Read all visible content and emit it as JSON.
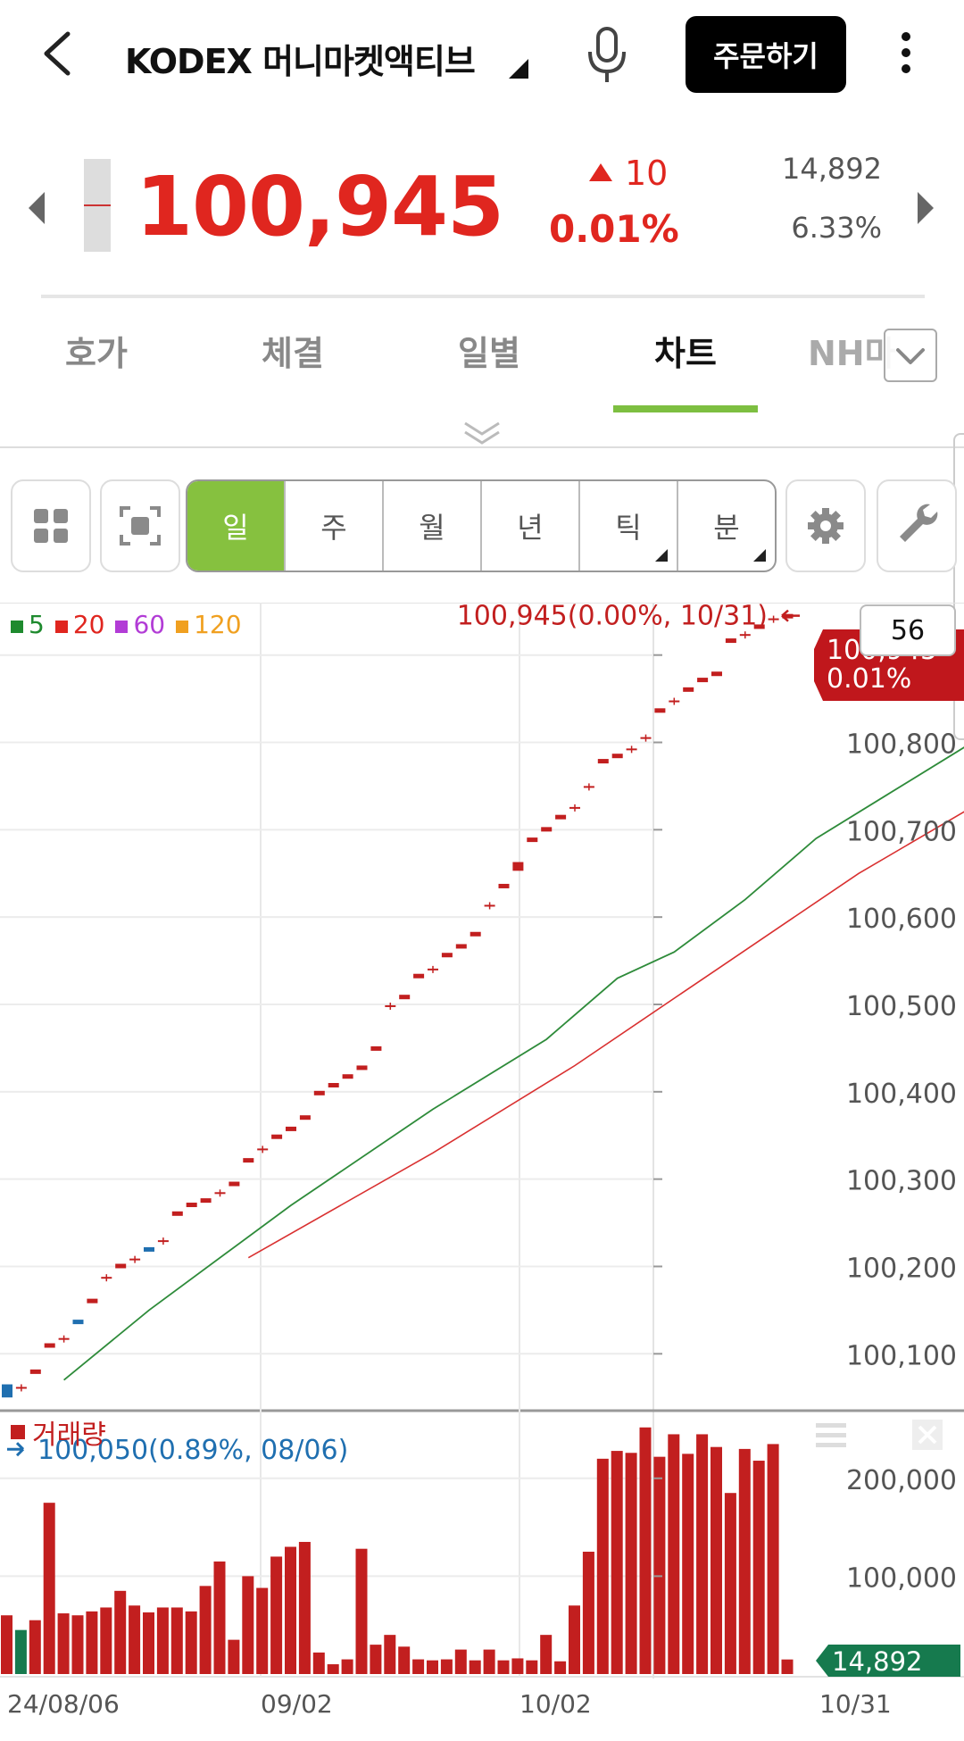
{
  "header": {
    "title": "KODEX 머니마켓액티브",
    "order_label": "주문하기"
  },
  "quote": {
    "price": "100,945",
    "change": "10",
    "change_pct": "0.01%",
    "volume": "14,892",
    "turnover_rate": "6.33%",
    "up_color": "#e0261f"
  },
  "tabs": [
    {
      "label": "호가"
    },
    {
      "label": "체결"
    },
    {
      "label": "일별"
    },
    {
      "label": "차트",
      "active": true
    },
    {
      "label": "NH마"
    }
  ],
  "toolbar": {
    "periods": [
      {
        "label": "일",
        "active": true
      },
      {
        "label": "주"
      },
      {
        "label": "월"
      },
      {
        "label": "년"
      },
      {
        "label": "틱",
        "has_menu": true
      },
      {
        "label": "분",
        "has_menu": true
      }
    ],
    "icons": [
      "grid-icon",
      "capture-icon",
      "gear-icon",
      "wrench-icon"
    ],
    "accent": "#86c13f"
  },
  "chart": {
    "ma_legend": [
      {
        "label": "5",
        "color": "#1e8a2e"
      },
      {
        "label": "20",
        "color": "#e0261f"
      },
      {
        "label": "60",
        "color": "#b23cd6"
      },
      {
        "label": "120",
        "color": "#f0a020"
      }
    ],
    "qty_badge": "56",
    "high_annotation": "100,945(0.00%, 10/31)",
    "low_annotation": "100,050(0.89%, 08/06)",
    "last_price_tag": "100,945",
    "last_pct_tag": "0.01%",
    "volume_label": "거래량",
    "volume_tag": "14,892",
    "x_labels": [
      "24/08/06",
      "09/02",
      "10/02",
      "10/31"
    ]
  },
  "chart_data": [
    {
      "type": "candlestick",
      "title": "",
      "ylim": [
        100040,
        100960
      ],
      "yticks": [
        100100,
        100200,
        100300,
        100400,
        100500,
        100600,
        100700,
        100800,
        100900
      ],
      "ytick_labels": [
        "100,100",
        "100,200",
        "100,300",
        "100,400",
        "100,500",
        "100,600",
        "100,700",
        "100,800",
        "100,900"
      ],
      "x_tick_labels": [
        "24/08/06",
        "09/02",
        "10/02",
        "10/31"
      ],
      "candles": [
        {
          "o": 100050,
          "c": 100065,
          "d": -1
        },
        {
          "o": 100061,
          "c": 100061,
          "d": 0
        },
        {
          "o": 100076,
          "c": 100080,
          "d": 1
        },
        {
          "o": 100106,
          "c": 100110,
          "d": 1
        },
        {
          "o": 100117,
          "c": 100117,
          "d": 0
        },
        {
          "o": 100137,
          "c": 100133,
          "d": -1
        },
        {
          "o": 100157,
          "c": 100161,
          "d": 1
        },
        {
          "o": 100187,
          "c": 100187,
          "d": 0
        },
        {
          "o": 100197,
          "c": 100201,
          "d": 1
        },
        {
          "o": 100208,
          "c": 100208,
          "d": 0
        },
        {
          "o": 100220,
          "c": 100216,
          "d": -1
        },
        {
          "o": 100229,
          "c": 100229,
          "d": 0
        },
        {
          "o": 100257,
          "c": 100261,
          "d": 1
        },
        {
          "o": 100267,
          "c": 100271,
          "d": 1
        },
        {
          "o": 100272,
          "c": 100276,
          "d": 1
        },
        {
          "o": 100284,
          "c": 100284,
          "d": 0
        },
        {
          "o": 100291,
          "c": 100295,
          "d": 1
        },
        {
          "o": 100318,
          "c": 100322,
          "d": 1
        },
        {
          "o": 100334,
          "c": 100334,
          "d": 0
        },
        {
          "o": 100345,
          "c": 100349,
          "d": 1
        },
        {
          "o": 100354,
          "c": 100358,
          "d": 1
        },
        {
          "o": 100367,
          "c": 100371,
          "d": 1
        },
        {
          "o": 100395,
          "c": 100399,
          "d": 1
        },
        {
          "o": 100404,
          "c": 100408,
          "d": 1
        },
        {
          "o": 100414,
          "c": 100418,
          "d": 1
        },
        {
          "o": 100424,
          "c": 100428,
          "d": 1
        },
        {
          "o": 100446,
          "c": 100450,
          "d": 1
        },
        {
          "o": 100498,
          "c": 100498,
          "d": 0
        },
        {
          "o": 100505,
          "c": 100509,
          "d": 1
        },
        {
          "o": 100529,
          "c": 100533,
          "d": 1
        },
        {
          "o": 100540,
          "c": 100540,
          "d": 0
        },
        {
          "o": 100553,
          "c": 100557,
          "d": 1
        },
        {
          "o": 100563,
          "c": 100567,
          "d": 1
        },
        {
          "o": 100577,
          "c": 100581,
          "d": 1
        },
        {
          "o": 100613,
          "c": 100613,
          "d": 0
        },
        {
          "o": 100632,
          "c": 100636,
          "d": 1
        },
        {
          "o": 100653,
          "c": 100663,
          "d": 1
        },
        {
          "o": 100685,
          "c": 100689,
          "d": 1
        },
        {
          "o": 100697,
          "c": 100701,
          "d": 1
        },
        {
          "o": 100711,
          "c": 100715,
          "d": 1
        },
        {
          "o": 100725,
          "c": 100725,
          "d": 0
        },
        {
          "o": 100749,
          "c": 100749,
          "d": 0
        },
        {
          "o": 100775,
          "c": 100779,
          "d": 1
        },
        {
          "o": 100781,
          "c": 100785,
          "d": 1
        },
        {
          "o": 100792,
          "c": 100792,
          "d": 0
        },
        {
          "o": 100805,
          "c": 100805,
          "d": 0
        },
        {
          "o": 100833,
          "c": 100837,
          "d": 1
        },
        {
          "o": 100847,
          "c": 100847,
          "d": 0
        },
        {
          "o": 100857,
          "c": 100861,
          "d": 1
        },
        {
          "o": 100868,
          "c": 100872,
          "d": 1
        },
        {
          "o": 100875,
          "c": 100879,
          "d": 1
        },
        {
          "o": 100913,
          "c": 100917,
          "d": 1
        },
        {
          "o": 100923,
          "c": 100923,
          "d": 0
        },
        {
          "o": 100929,
          "c": 100933,
          "d": 1
        },
        {
          "o": 100941,
          "c": 100941,
          "d": 0
        },
        {
          "o": 100941,
          "c": 100945,
          "d": 1
        }
      ],
      "ma5": [
        [
          4,
          100070
        ],
        [
          10,
          100150
        ],
        [
          20,
          100270
        ],
        [
          30,
          100380
        ],
        [
          38,
          100460
        ],
        [
          43,
          100530
        ],
        [
          47,
          100560
        ],
        [
          52,
          100620
        ],
        [
          57,
          100690
        ],
        [
          62,
          100740
        ],
        [
          67,
          100790
        ],
        [
          72,
          100840
        ],
        [
          77,
          100880
        ],
        [
          80,
          100918
        ]
      ],
      "ma20": [
        [
          17,
          100210
        ],
        [
          30,
          100330
        ],
        [
          40,
          100430
        ],
        [
          50,
          100540
        ],
        [
          60,
          100650
        ],
        [
          70,
          100745
        ],
        [
          80,
          100817
        ]
      ]
    },
    {
      "type": "bar",
      "title": "",
      "ylim": [
        0,
        260000
      ],
      "yticks": [
        100000,
        200000
      ],
      "ytick_labels": [
        "100,000",
        "200,000"
      ],
      "values": [
        60000,
        45000,
        55000,
        175000,
        62000,
        60000,
        64000,
        68000,
        85000,
        70000,
        63000,
        68000,
        68000,
        64000,
        90000,
        115000,
        35000,
        100000,
        88000,
        120000,
        130000,
        135000,
        22000,
        10000,
        15000,
        128000,
        30000,
        40000,
        28000,
        15000,
        14000,
        15000,
        25000,
        14000,
        25000,
        14000,
        16000,
        14000,
        40000,
        13000,
        70000,
        125000,
        220000,
        228000,
        226000,
        252000,
        222000,
        245000,
        225000,
        245000,
        232000,
        185000,
        230000,
        218000,
        235000,
        14892
      ],
      "colors": [
        "red",
        "green",
        "red",
        "red",
        "red",
        "red",
        "red",
        "red",
        "red",
        "red",
        "red",
        "red",
        "red",
        "red",
        "red",
        "red",
        "red",
        "red",
        "red",
        "red",
        "red",
        "red",
        "red",
        "red",
        "red",
        "red",
        "red",
        "red",
        "red",
        "red",
        "red",
        "red",
        "red",
        "red",
        "red",
        "red",
        "red",
        "red",
        "red",
        "red",
        "red",
        "red",
        "red",
        "red",
        "red",
        "red",
        "red",
        "red",
        "red",
        "red",
        "red",
        "red",
        "red",
        "red",
        "red",
        "red"
      ]
    }
  ]
}
